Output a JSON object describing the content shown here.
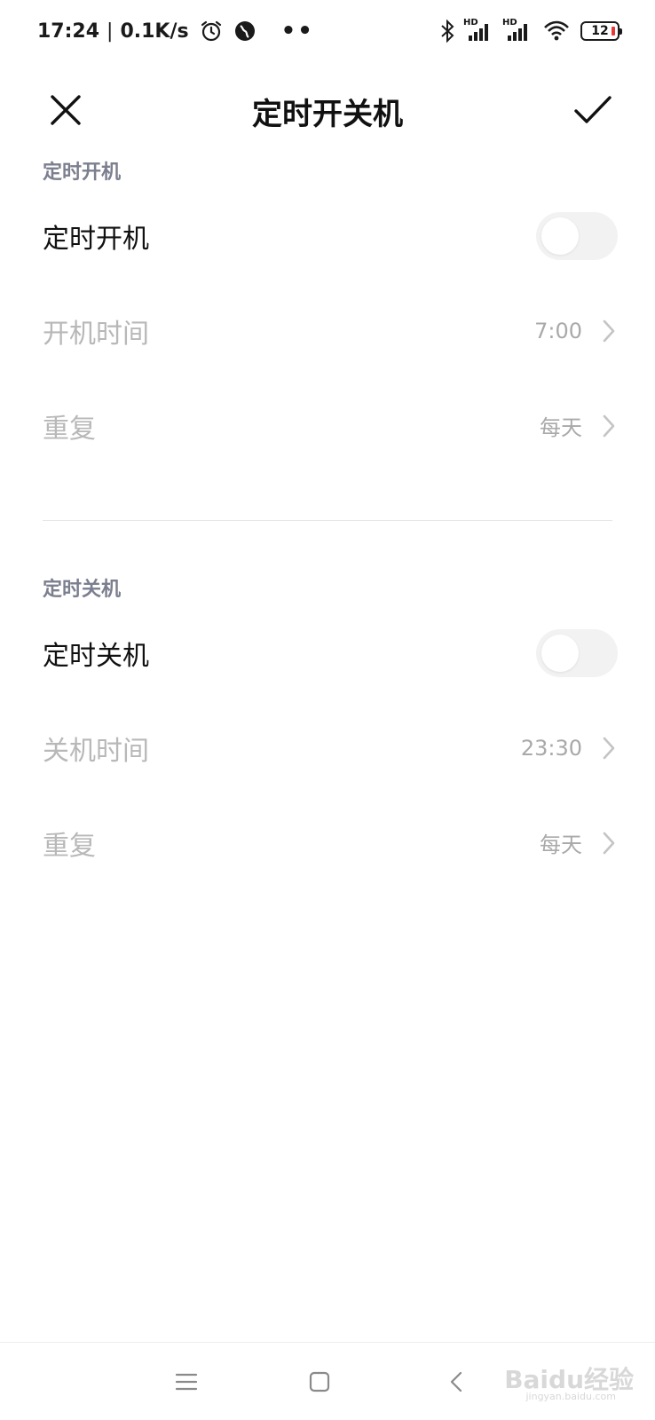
{
  "status_bar": {
    "time": "17:24",
    "separator": "|",
    "speed": "0.1K/s",
    "sim1_label": "HD",
    "sim2_label": "HD",
    "battery": "12"
  },
  "header": {
    "title": "定时开关机"
  },
  "power_on": {
    "section_title": "定时开机",
    "toggle_label": "定时开机",
    "toggle_on": false,
    "time_label": "开机时间",
    "time_value": "7:00",
    "repeat_label": "重复",
    "repeat_value": "每天"
  },
  "power_off": {
    "section_title": "定时关机",
    "toggle_label": "定时关机",
    "toggle_on": false,
    "time_label": "关机时间",
    "time_value": "23:30",
    "repeat_label": "重复",
    "repeat_value": "每天"
  },
  "watermark": {
    "brand": "Baidu经验",
    "url": "jingyan.baidu.com"
  },
  "colors": {
    "section_title": "#7b7f8e",
    "disabled_text": "#b8b8b8",
    "battery_low": "#e53935"
  }
}
